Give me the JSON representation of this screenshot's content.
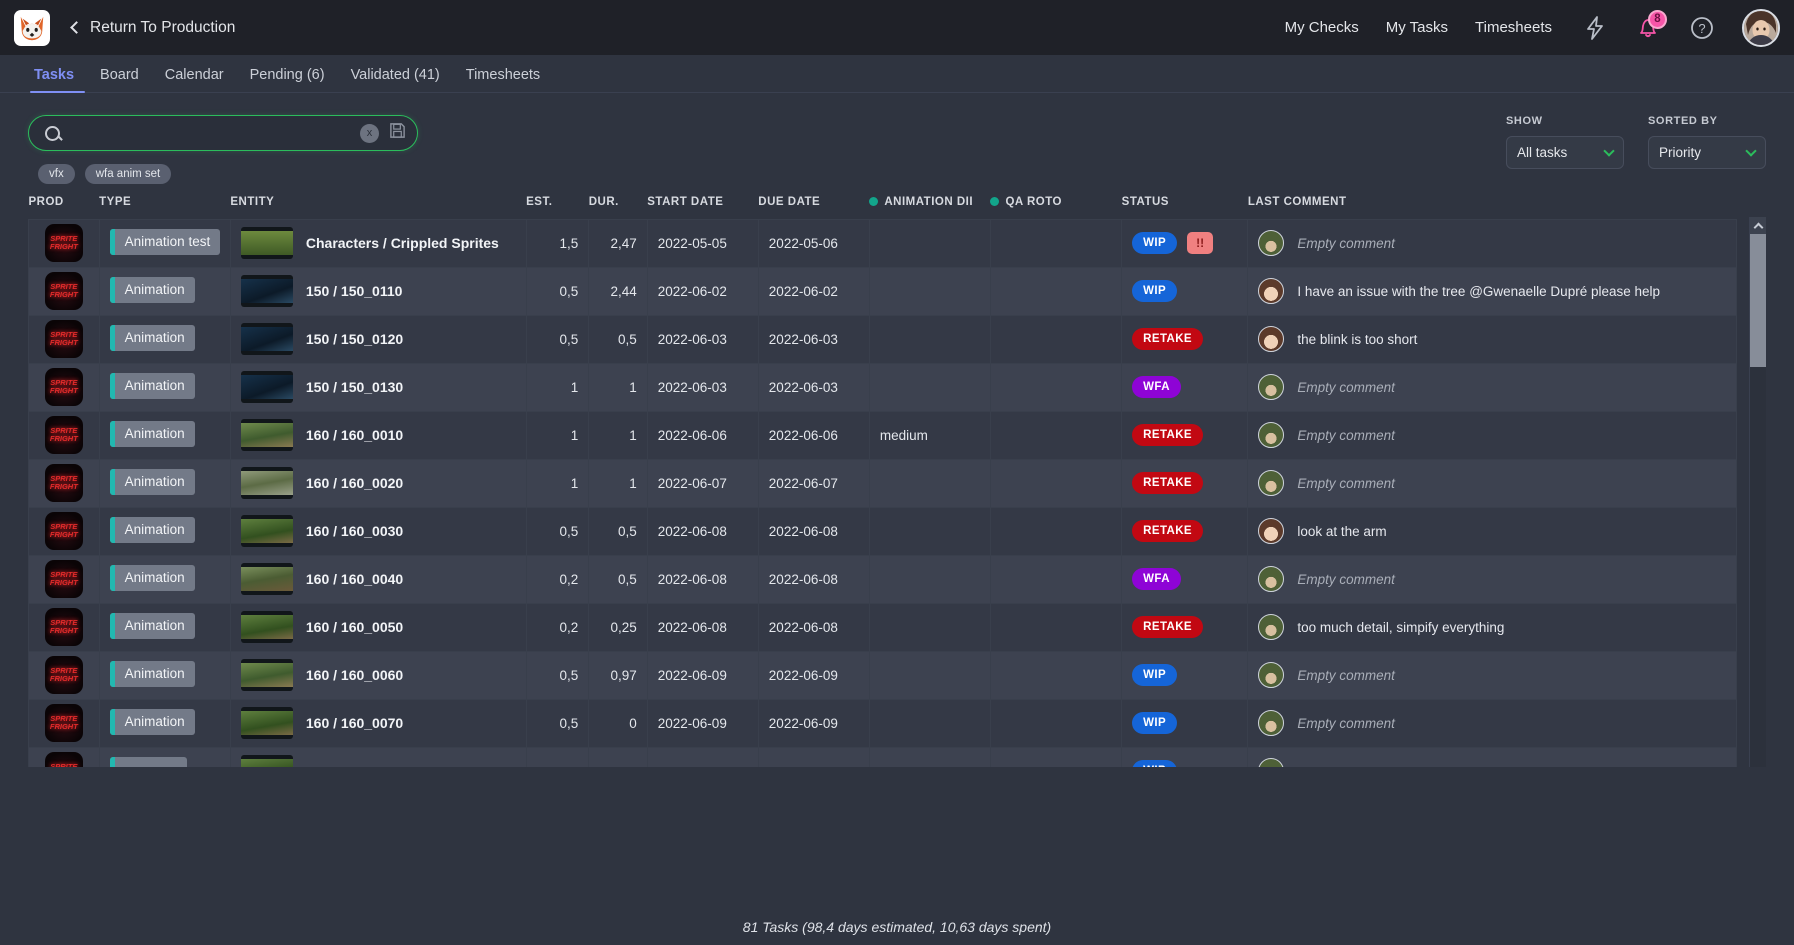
{
  "topbar": {
    "logo_icon": "fox-logo-icon",
    "back_label": "Return To Production",
    "nav": [
      {
        "label": "My Checks"
      },
      {
        "label": "My Tasks"
      },
      {
        "label": "Timesheets"
      }
    ],
    "bolt_icon": "lightning-bolt-icon",
    "bell_icon": "bell-icon",
    "notification_count": "8",
    "help_icon": "help-circle-icon",
    "avatar_icon": "user-avatar"
  },
  "tabs": [
    {
      "label": "Tasks",
      "active": true
    },
    {
      "label": "Board",
      "active": false
    },
    {
      "label": "Calendar",
      "active": false
    },
    {
      "label": "Pending (6)",
      "active": false
    },
    {
      "label": "Validated (41)",
      "active": false
    },
    {
      "label": "Timesheets",
      "active": false
    }
  ],
  "search": {
    "icon": "search-icon",
    "value": "",
    "placeholder": "",
    "clear_label": "x",
    "save_icon": "save-disk-icon",
    "chips": [
      "vfx",
      "wfa anim set"
    ]
  },
  "filters": {
    "show": {
      "label": "SHOW",
      "value": "All tasks"
    },
    "sorted_by": {
      "label": "SORTED BY",
      "value": "Priority"
    }
  },
  "table": {
    "columns": [
      {
        "key": "prod",
        "label": "PROD",
        "dot": false
      },
      {
        "key": "type",
        "label": "TYPE",
        "dot": false
      },
      {
        "key": "entity",
        "label": "ENTITY",
        "dot": false
      },
      {
        "key": "est",
        "label": "EST.",
        "dot": false
      },
      {
        "key": "dur",
        "label": "DUR.",
        "dot": false
      },
      {
        "key": "start_date",
        "label": "START DATE",
        "dot": false
      },
      {
        "key": "due_date",
        "label": "DUE DATE",
        "dot": false
      },
      {
        "key": "animation_dir",
        "label": "ANIMATION DII",
        "dot": true
      },
      {
        "key": "qa_roto",
        "label": "QA ROTO",
        "dot": true
      },
      {
        "key": "status",
        "label": "STATUS",
        "dot": false
      },
      {
        "key": "last_comment",
        "label": "LAST COMMENT",
        "dot": false
      }
    ],
    "prod_thumb_text": "SPRITE FRIGHT",
    "rows": [
      {
        "prod": "SPRITE FRIGHT",
        "type": "Animation test",
        "entity": "Characters / Crippled Sprites",
        "thumb": "sprite-character",
        "est": "1,5",
        "dur": "2,47",
        "start_date": "2022-05-05",
        "due_date": "2022-05-06",
        "animation_dir": "",
        "qa_roto": "",
        "status": "WIP",
        "status_color": "#1565d8",
        "priority": "!!",
        "comment": "Empty comment",
        "comment_empty": true,
        "avatar": "person-a"
      },
      {
        "prod": "SPRITE FRIGHT",
        "type": "Animation",
        "entity": "150 / 150_0110",
        "thumb": "night-blue",
        "est": "0,5",
        "dur": "2,44",
        "start_date": "2022-06-02",
        "due_date": "2022-06-02",
        "animation_dir": "",
        "qa_roto": "",
        "status": "WIP",
        "status_color": "#1565d8",
        "priority": "",
        "comment": "I have an issue with the tree @Gwenaelle Dupré please help",
        "comment_empty": false,
        "avatar": "person-b"
      },
      {
        "prod": "SPRITE FRIGHT",
        "type": "Animation",
        "entity": "150 / 150_0120",
        "thumb": "night-blue",
        "est": "0,5",
        "dur": "0,5",
        "start_date": "2022-06-03",
        "due_date": "2022-06-03",
        "animation_dir": "",
        "qa_roto": "",
        "status": "RETAKE",
        "status_color": "#c20812",
        "priority": "",
        "comment": "the blink is too short",
        "comment_empty": false,
        "avatar": "person-b"
      },
      {
        "prod": "SPRITE FRIGHT",
        "type": "Animation",
        "entity": "150 / 150_0130",
        "thumb": "night-blue",
        "est": "1",
        "dur": "1",
        "start_date": "2022-06-03",
        "due_date": "2022-06-03",
        "animation_dir": "",
        "qa_roto": "",
        "status": "WFA",
        "status_color": "#8e04d6",
        "priority": "",
        "comment": "Empty comment",
        "comment_empty": true,
        "avatar": "person-a"
      },
      {
        "prod": "SPRITE FRIGHT",
        "type": "Animation",
        "entity": "160 / 160_0010",
        "thumb": "forest-wide",
        "est": "1",
        "dur": "1",
        "start_date": "2022-06-06",
        "due_date": "2022-06-06",
        "animation_dir": "medium",
        "qa_roto": "",
        "status": "RETAKE",
        "status_color": "#c20812",
        "priority": "",
        "comment": "Empty comment",
        "comment_empty": true,
        "avatar": "person-a"
      },
      {
        "prod": "SPRITE FRIGHT",
        "type": "Animation",
        "entity": "160 / 160_0020",
        "thumb": "forest-ground",
        "est": "1",
        "dur": "1",
        "start_date": "2022-06-07",
        "due_date": "2022-06-07",
        "animation_dir": "",
        "qa_roto": "",
        "status": "RETAKE",
        "status_color": "#c20812",
        "priority": "",
        "comment": "Empty comment",
        "comment_empty": true,
        "avatar": "person-a"
      },
      {
        "prod": "SPRITE FRIGHT",
        "type": "Animation",
        "entity": "160 / 160_0030",
        "thumb": "forest-char",
        "est": "0,5",
        "dur": "0,5",
        "start_date": "2022-06-08",
        "due_date": "2022-06-08",
        "animation_dir": "",
        "qa_roto": "",
        "status": "RETAKE",
        "status_color": "#c20812",
        "priority": "",
        "comment": "look at the arm",
        "comment_empty": false,
        "avatar": "person-b"
      },
      {
        "prod": "SPRITE FRIGHT",
        "type": "Animation",
        "entity": "160 / 160_0040",
        "thumb": "branch-leaves",
        "est": "0,2",
        "dur": "0,5",
        "start_date": "2022-06-08",
        "due_date": "2022-06-08",
        "animation_dir": "",
        "qa_roto": "",
        "status": "WFA",
        "status_color": "#8e04d6",
        "priority": "",
        "comment": "Empty comment",
        "comment_empty": true,
        "avatar": "person-a"
      },
      {
        "prod": "SPRITE FRIGHT",
        "type": "Animation",
        "entity": "160 / 160_0050",
        "thumb": "forest-char",
        "est": "0,2",
        "dur": "0,25",
        "start_date": "2022-06-08",
        "due_date": "2022-06-08",
        "animation_dir": "",
        "qa_roto": "",
        "status": "RETAKE",
        "status_color": "#c20812",
        "priority": "",
        "comment": "too much detail, simpify everything",
        "comment_empty": false,
        "avatar": "person-a"
      },
      {
        "prod": "SPRITE FRIGHT",
        "type": "Animation",
        "entity": "160 / 160_0060",
        "thumb": "forest-wide",
        "est": "0,5",
        "dur": "0,97",
        "start_date": "2022-06-09",
        "due_date": "2022-06-09",
        "animation_dir": "",
        "qa_roto": "",
        "status": "WIP",
        "status_color": "#1565d8",
        "priority": "",
        "comment": "Empty comment",
        "comment_empty": true,
        "avatar": "person-a"
      },
      {
        "prod": "SPRITE FRIGHT",
        "type": "Animation",
        "entity": "160 / 160_0070",
        "thumb": "forest-char",
        "est": "0,5",
        "dur": "0",
        "start_date": "2022-06-09",
        "due_date": "2022-06-09",
        "animation_dir": "",
        "qa_roto": "",
        "status": "WIP",
        "status_color": "#1565d8",
        "priority": "",
        "comment": "Empty comment",
        "comment_empty": true,
        "avatar": "person-a"
      },
      {
        "prod": "SPRITE FRIGHT",
        "type": "Animation",
        "entity": "",
        "thumb": "forest-char",
        "est": "",
        "dur": "",
        "start_date": "",
        "due_date": "",
        "animation_dir": "",
        "qa_roto": "",
        "status": "WIP",
        "status_color": "#1565d8",
        "priority": "",
        "comment": "",
        "comment_empty": false,
        "avatar": "person-a"
      }
    ]
  },
  "footer": {
    "summary": "81 Tasks (98,4 days estimated, 10,63 days spent)"
  },
  "colors": {
    "accent_green": "#2bbd5c",
    "tab_active": "#7f8ff4",
    "teal_dot": "#12a58b",
    "wip": "#1565d8",
    "retake": "#c20812",
    "wfa": "#8e04d6",
    "priority": "#f08080",
    "badge_pink": "#f655a8"
  }
}
